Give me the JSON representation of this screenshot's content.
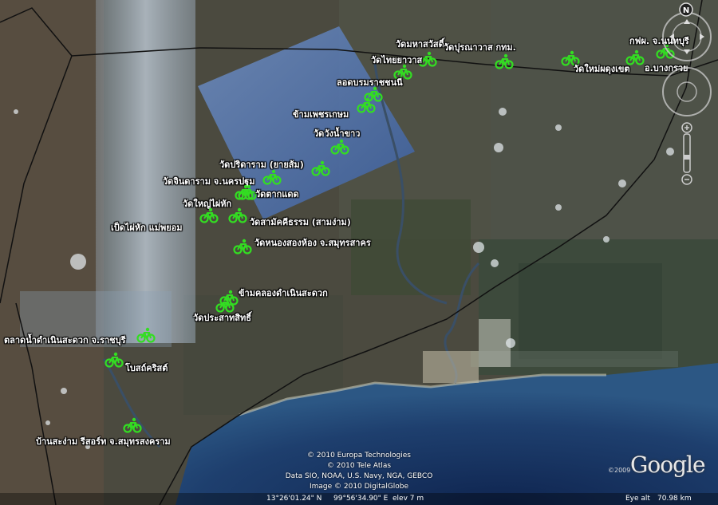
{
  "map": {
    "markers": [
      {
        "id": "wat-mahasawat",
        "label": "วัดมหาสวัสดิ์"
      },
      {
        "id": "wat-thaiyawat",
        "label": "วัดไทยยาวาส"
      },
      {
        "id": "wat-pasnawas",
        "label": "วัดปุรณาวาส กทม."
      },
      {
        "id": "wat-mai-phadung-khet",
        "label": "วัดใหม่ผดุงเขต"
      },
      {
        "id": "egat-nonthaburi",
        "label": "กฟผ. จ.นนทบุรี"
      },
      {
        "id": "bang-kruai",
        "label": "อ.บางกรวย"
      },
      {
        "id": "lot-borommaratchachonnani",
        "label": "ลอดบรมราชชนนี"
      },
      {
        "id": "kham-phetkasem",
        "label": "ข้ามเพชรเกษม"
      },
      {
        "id": "wat-wang-nam-khao",
        "label": "วัดวังน้ำขาว"
      },
      {
        "id": "wat-pridaram",
        "label": "วัดปริดาราม (ยายส้ม)"
      },
      {
        "id": "wat-chindaram",
        "label": "วัดจินดาราม จ.นครปฐม"
      },
      {
        "id": "wat-yai-phai-hak",
        "label": "วัดใหญ่ไผ่หัก"
      },
      {
        "id": "wat-tak-daet",
        "label": "วัดตากแดด"
      },
      {
        "id": "ped-phai-hak",
        "label": "เป็ดไผ่หัก แม่พยอม"
      },
      {
        "id": "wat-samakkhitham",
        "label": "วัดสามัคคีธรรม (สามง่าม)"
      },
      {
        "id": "wat-nong-song-hong",
        "label": "วัดหนองสองห้อง จ.สมุทรสาคร"
      },
      {
        "id": "kham-khlong-damnoen",
        "label": "ข้ามคลองดำเนินสะดวก"
      },
      {
        "id": "wat-prasat-sit",
        "label": "วัดประสาทสิทธิ์"
      },
      {
        "id": "damnoen-market",
        "label": "ตลาดน้ำดำเนินสะดวก จ.ราชบุรี"
      },
      {
        "id": "bost-christ",
        "label": "โบสถ์คริสต์"
      },
      {
        "id": "baan-sa-ngam",
        "label": "บ้านสะง่าม รีสอร์ท จ.สมุทรสงคราม"
      }
    ]
  },
  "credits": [
    "© 2010 Europa Technologies",
    "© 2010 Tele Atlas",
    "Data SIO, NOAA, U.S. Navy, NGA, GEBCO",
    "Image © 2010 DigitalGlobe"
  ],
  "logo": {
    "year": "©2009",
    "text": "Google"
  },
  "statusbar": {
    "lat": "13°26'01.24\" N",
    "lon": "99°56'34.90\" E",
    "elev": "elev   7 m",
    "eye_label": "Eye alt",
    "eye_value": "70.98 km"
  },
  "compass": {
    "north": "N"
  },
  "colors": {
    "marker": "#33dd22",
    "land": "#4a4a3e",
    "sea": "#1e3c66"
  }
}
